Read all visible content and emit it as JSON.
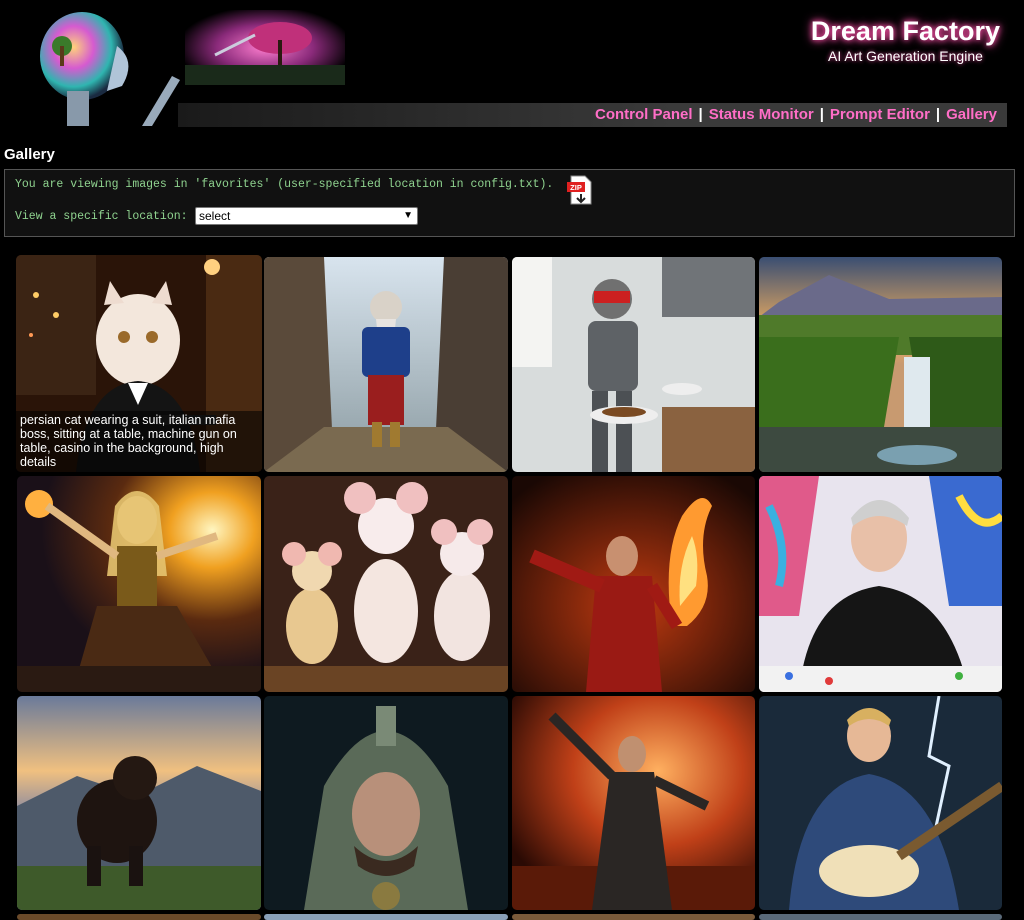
{
  "header": {
    "brand_title": "Dream Factory",
    "brand_subtitle": "AI Art Generation Engine",
    "nav": [
      "Control Panel",
      "Status Monitor",
      "Prompt Editor",
      "Gallery"
    ],
    "nav_separator": "|",
    "accent_color": "#ff6ec7"
  },
  "page": {
    "section_title": "Gallery"
  },
  "info": {
    "viewing_text": "You are viewing images in 'favorites' (user-specified location in config.txt).",
    "location_label": "View a specific location:",
    "location_select_value": "select",
    "zip_icon_text": "ZIP"
  },
  "gallery": {
    "captions": [
      "persian cat wearing a suit, italian mafia boss, sitting at a table, machine gun on table, casino in the background, high details"
    ],
    "tiles": [
      {
        "subject": "persian-cat-mafia"
      },
      {
        "subject": "wizard-canyon"
      },
      {
        "subject": "robot-chef-kitchen"
      },
      {
        "subject": "waterfall-landscape"
      },
      {
        "subject": "blonde-sorceress"
      },
      {
        "subject": "three-mice"
      },
      {
        "subject": "fire-dancer"
      },
      {
        "subject": "painter-man"
      },
      {
        "subject": "werewolf-mountains"
      },
      {
        "subject": "hooded-warrior"
      },
      {
        "subject": "robed-figure-fire"
      },
      {
        "subject": "guitarist-storm"
      }
    ]
  }
}
